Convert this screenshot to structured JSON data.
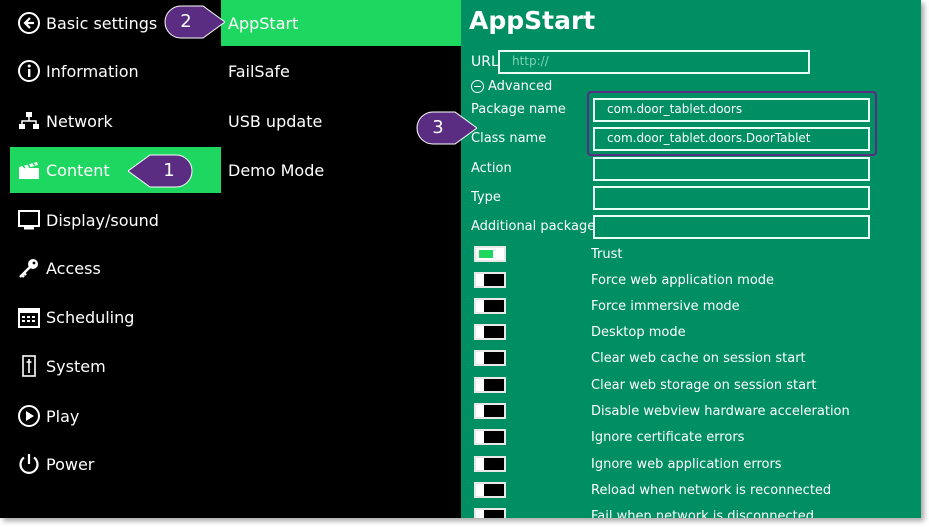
{
  "nav": {
    "items": [
      {
        "label": "Basic settings",
        "icon": "back-arrow-icon"
      },
      {
        "label": "Information",
        "icon": "info-icon"
      },
      {
        "label": "Network",
        "icon": "network-icon"
      },
      {
        "label": "Content",
        "icon": "clapperboard-icon"
      },
      {
        "label": "Display/sound",
        "icon": "monitor-icon"
      },
      {
        "label": "Access",
        "icon": "key-icon"
      },
      {
        "label": "Scheduling",
        "icon": "calendar-icon"
      },
      {
        "label": "System",
        "icon": "system-icon"
      },
      {
        "label": "Play",
        "icon": "play-icon"
      },
      {
        "label": "Power",
        "icon": "power-icon"
      }
    ],
    "active": "Content"
  },
  "subnav": {
    "items": [
      "AppStart",
      "FailSafe",
      "USB update",
      "Demo Mode"
    ],
    "active": "AppStart"
  },
  "panel": {
    "title": "AppStart",
    "url_label": "URL",
    "url_placeholder": "http://",
    "advanced_label": "Advanced",
    "package_label": "Package name",
    "package_value": "com.door_tablet.doors",
    "class_label": "Class name",
    "class_value": "com.door_tablet.doors.DoorTablet",
    "action_label": "Action",
    "action_value": "",
    "type_label": "Type",
    "type_value": "",
    "additional_label": "Additional packages",
    "additional_value": "",
    "options": [
      {
        "label": "Trust",
        "on": true
      },
      {
        "label": "Force web application mode",
        "on": false
      },
      {
        "label": "Force immersive mode",
        "on": false
      },
      {
        "label": "Desktop mode",
        "on": false
      },
      {
        "label": "Clear web cache on session start",
        "on": false
      },
      {
        "label": "Clear web storage on session start",
        "on": false
      },
      {
        "label": "Disable webview hardware acceleration",
        "on": false
      },
      {
        "label": "Ignore certificate errors",
        "on": false
      },
      {
        "label": "Ignore web application errors",
        "on": false
      },
      {
        "label": "Reload when network is reconnected",
        "on": false
      },
      {
        "label": "Fail when network is disconnected",
        "on": false
      }
    ]
  },
  "callouts": [
    "1",
    "2",
    "3"
  ],
  "colors": {
    "accent": "#1ed760",
    "panel": "#008f62",
    "callout": "#5a2d82"
  }
}
